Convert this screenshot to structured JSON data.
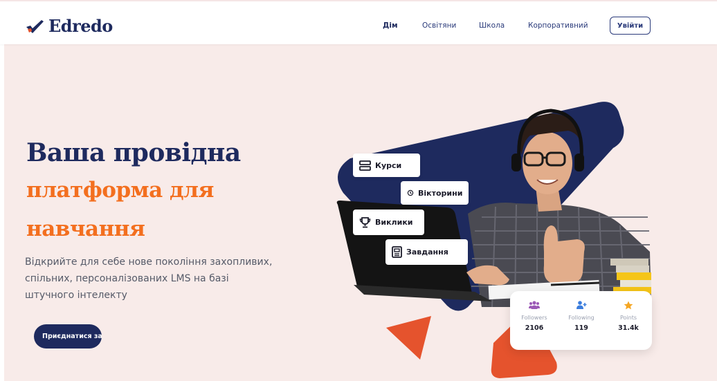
{
  "brand": {
    "name": "Edredo",
    "accent_navy": "#1e2a5e",
    "accent_orange": "#f36f1f",
    "accent_red": "#e5532d"
  },
  "nav": {
    "items": [
      {
        "label": "Дім",
        "active": true
      },
      {
        "label": "Освітяни",
        "active": false
      },
      {
        "label": "Школа",
        "active": false
      },
      {
        "label": "Корпоративний",
        "active": false
      }
    ],
    "login_label": "Увійти"
  },
  "hero": {
    "title_line1": "Ваша провідна",
    "title_line2": "платформа для",
    "title_line3": "навчання",
    "description": "Відкрийте для себе нове покоління захопливих, спільних, персоналізованих LMS на базі штучного інтелекту",
    "cta_label": "Приєднатися зараз"
  },
  "chips": [
    {
      "label": "Курси",
      "icon": "stack-icon"
    },
    {
      "label": "Вікторини",
      "icon": "clock-icon"
    },
    {
      "label": "Виклики",
      "icon": "trophy-icon"
    },
    {
      "label": "Завдання",
      "icon": "document-icon"
    }
  ],
  "stats": [
    {
      "label": "Followers",
      "value": "2106",
      "icon": "followers-icon",
      "color": "#9b59b6"
    },
    {
      "label": "Following",
      "value": "119",
      "icon": "add-user-icon",
      "color": "#3b7ddd"
    },
    {
      "label": "Points",
      "value": "31.4k",
      "icon": "star-icon",
      "color": "#f5a623"
    }
  ]
}
